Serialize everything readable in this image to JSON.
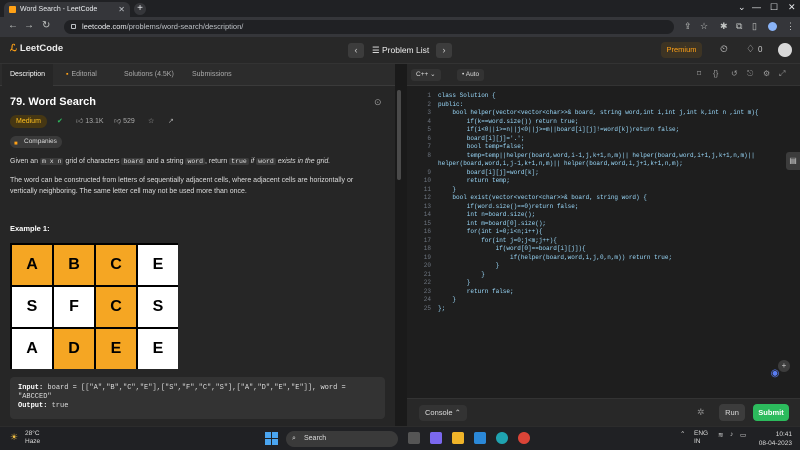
{
  "browser": {
    "tab_title": "Word Search - LeetCode",
    "url_host": "leetcode.com",
    "url_path": "/problems/word-search/description/"
  },
  "header": {
    "logo_text": "LeetCode",
    "problem_list_label": "Problem List",
    "premium_label": "Premium",
    "count": "0"
  },
  "left_tabs": [
    {
      "label": "Description"
    },
    {
      "label": "Editorial"
    },
    {
      "label": "Solutions (4.5K)"
    },
    {
      "label": "Submissions"
    }
  ],
  "problem": {
    "title": "79. Word Search",
    "difficulty": "Medium",
    "likes": "13.1K",
    "dislikes": "529",
    "companies_label": "Companies",
    "desc1_a": "Given an ",
    "desc1_mxn": "m x n",
    "desc1_b": " grid of characters ",
    "desc1_board": "board",
    "desc1_c": " and a string ",
    "desc1_word": "word",
    "desc1_d": ", return ",
    "desc1_true": "true",
    "desc1_e": " if ",
    "desc1_word2": "word",
    "desc1_f": " exists in the grid.",
    "desc2": "The word can be constructed from letters of sequentially adjacent cells, where adjacent cells are horizontally or vertically neighboring. The same letter cell may not be used more than once.",
    "example_title": "Example 1:",
    "grid": [
      [
        "A",
        "B",
        "C",
        "E"
      ],
      [
        "S",
        "F",
        "C",
        "S"
      ],
      [
        "A",
        "D",
        "E",
        "E"
      ]
    ],
    "highlight": [
      [
        true,
        true,
        true,
        false
      ],
      [
        false,
        false,
        true,
        false
      ],
      [
        false,
        true,
        true,
        false
      ]
    ],
    "input_label": "Input:",
    "input_value": "board = [[\"A\",\"B\",\"C\",\"E\"],[\"S\",\"F\",\"C\",\"S\"],[\"A\",\"D\",\"E\",\"E\"]], word = \"ABCCED\"",
    "output_label": "Output:",
    "output_value": "true"
  },
  "editor": {
    "language": "C++",
    "mode": "Auto",
    "lines": [
      "class Solution {",
      "public:",
      "    bool helper(vector<vector<char>>& board, string word,int i,int j,int k,int n ,int m){",
      "        if(k==word.size()) return true;",
      "        if(i<0||i>=n||j<0||j>=m||board[i][j]!=word[k])return false;",
      "        board[i][j]='.';",
      "        bool temp=false;",
      "        temp=temp||helper(board,word,i-1,j,k+1,n,m)|| helper(board,word,i+1,j,k+1,n,m)||",
      "helper(board,word,i,j-1,k+1,n,m)|| helper(board,word,i,j+1,k+1,n,m);",
      "        board[i][j]=word[k];",
      "        return temp;",
      "    }",
      "    bool exist(vector<vector<char>>& board, string word) {",
      "        if(word.size()==0)return false;",
      "        int n=board.size();",
      "        int m=board[0].size();",
      "        for(int i=0;i<n;i++){",
      "            for(int j=0;j<m;j++){",
      "                if(word[0]==board[i][j]){",
      "                    if(helper(board,word,i,j,0,n,m)) return true;",
      "                }",
      "            }",
      "        }",
      "        return false;",
      "    }",
      "};"
    ],
    "line_numbers": [
      "1",
      "2",
      "3",
      "4",
      "5",
      "6",
      "7",
      "8",
      "",
      "9",
      "10",
      "11",
      "12",
      "13",
      "14",
      "15",
      "16",
      "17",
      "18",
      "19",
      "20",
      "21",
      "22",
      "23",
      "24",
      "25"
    ]
  },
  "console": {
    "console_label": "Console",
    "run_label": "Run",
    "submit_label": "Submit"
  },
  "taskbar": {
    "temp": "28°C",
    "weather": "Haze",
    "search_label": "Search",
    "lang": "ENG",
    "region": "IN",
    "time": "10:41",
    "date": "08-04-2023"
  },
  "colors": {
    "accent": "#ffa116",
    "grid_highlight": "#f5a623",
    "submit": "#2cbb5d"
  }
}
